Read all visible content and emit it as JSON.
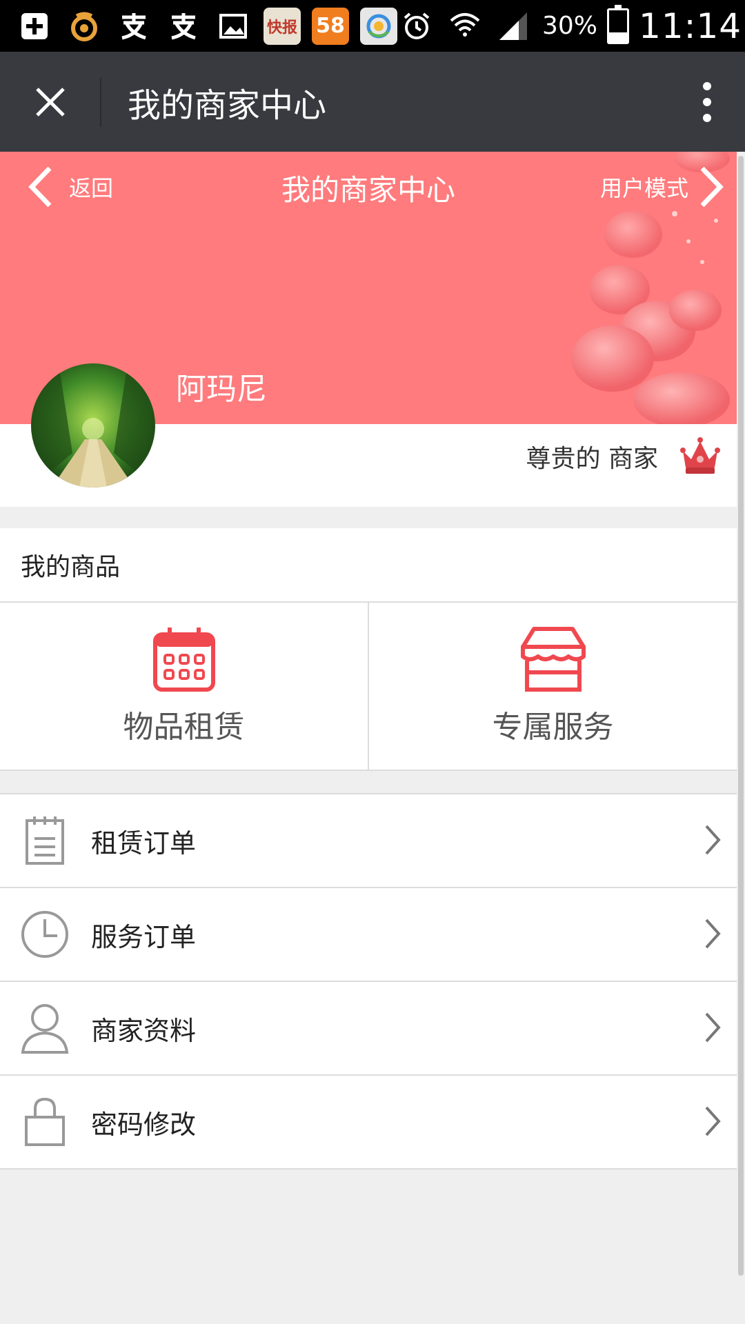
{
  "status_bar": {
    "battery_percent": "30%",
    "time": "11:14",
    "battery_level": 0.3,
    "icons": [
      "add-square-icon",
      "uc-browser-icon",
      "alipay-icon",
      "alipay-icon",
      "image-icon",
      "kuaibao-app-icon",
      "58-app-icon",
      "qq-browser-icon",
      "alarm-icon",
      "wifi-icon",
      "signal-icon",
      "battery-icon"
    ],
    "apps": {
      "kuaibao": "快报",
      "app58": "58"
    }
  },
  "titlebar": {
    "title": "我的商家中心"
  },
  "hero": {
    "back_label": "返回",
    "title": "我的商家中心",
    "usermode_label": "用户模式",
    "username": "阿玛尼",
    "bg_color": "#ff7b7d"
  },
  "profile": {
    "vip_label": "尊贵的 商家"
  },
  "goods": {
    "header": "我的商品",
    "items": [
      {
        "label": "物品租赁",
        "icon": "calendar-icon"
      },
      {
        "label": "专属服务",
        "icon": "store-icon"
      }
    ],
    "accent": "#f0484f"
  },
  "menu": {
    "items": [
      {
        "label": "租赁订单",
        "icon": "clipboard-icon"
      },
      {
        "label": "服务订单",
        "icon": "clock-icon"
      },
      {
        "label": "商家资料",
        "icon": "user-icon"
      },
      {
        "label": "密码修改",
        "icon": "lock-icon"
      }
    ]
  }
}
